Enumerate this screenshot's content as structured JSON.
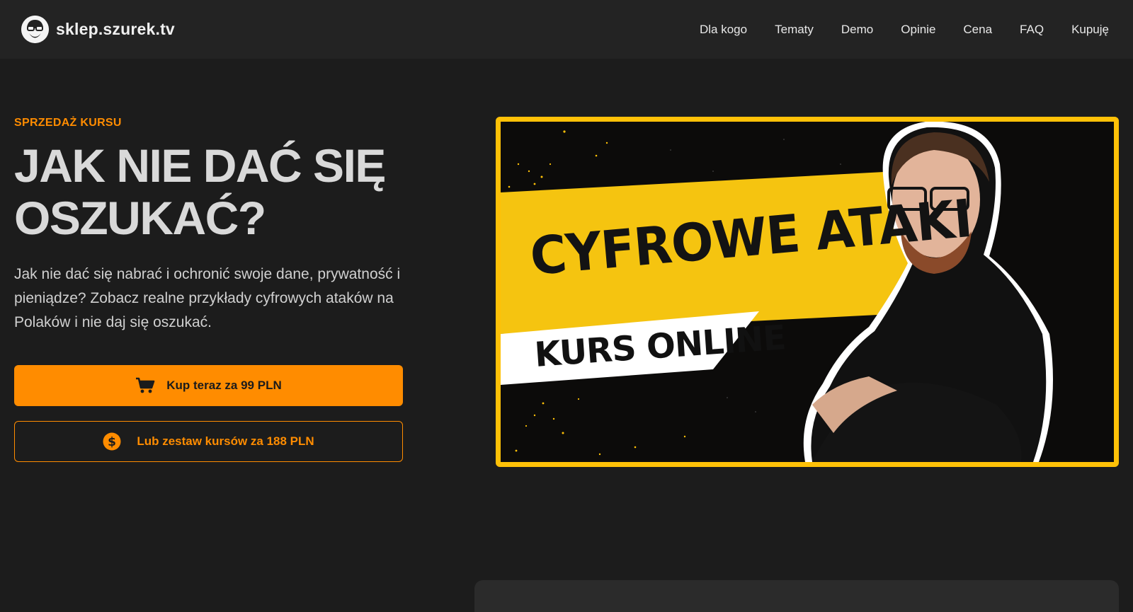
{
  "site": {
    "brand": "sklep.szurek.tv",
    "logo_icon": "glasses-face-icon"
  },
  "nav": {
    "items": [
      {
        "label": "Dla kogo"
      },
      {
        "label": "Tematy"
      },
      {
        "label": "Demo"
      },
      {
        "label": "Opinie"
      },
      {
        "label": "Cena"
      },
      {
        "label": "FAQ"
      },
      {
        "label": "Kupuję"
      }
    ]
  },
  "hero": {
    "eyebrow": "SPRZEDAŻ KURSU",
    "title_line1": "JAK NIE DAĆ SIĘ",
    "title_line2": "OSZUKAĆ?",
    "lead": "Jak nie dać się nabrać i ochronić swoje dane, prywatność i pieniądze? Zobacz realne przykłady cyfrowych ataków na Polaków i nie daj się oszukać.",
    "buy_button": {
      "label": "Kup teraz za 99 PLN",
      "icon": "cart-icon"
    },
    "bundle_button": {
      "label": "Lub zestaw kursów za 188 PLN",
      "icon": "dollar-coin-icon"
    }
  },
  "thumbnail": {
    "headline": "CYFROWE ATAKI",
    "subline": "KURS ONLINE"
  },
  "colors": {
    "accent": "#ff8c00",
    "thumbnail_frame": "#ffc107",
    "background": "#1c1c1c",
    "topbar": "#232323"
  }
}
